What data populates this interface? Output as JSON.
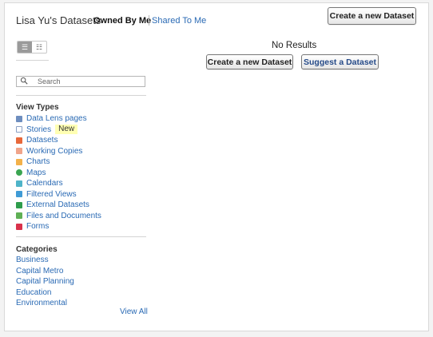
{
  "header": {
    "title": "Lisa Yu's Datasets",
    "tabs": [
      {
        "label": "Owned By Me",
        "active": true
      },
      {
        "label": "Shared To Me",
        "active": false
      }
    ],
    "create_button": "Create a new Dataset"
  },
  "view_toggle": {
    "options": [
      "list-detail-icon",
      "list-compact-icon"
    ],
    "selected": "list-detail-icon"
  },
  "search": {
    "placeholder": "Search",
    "value": ""
  },
  "view_types": {
    "heading": "View Types",
    "items": [
      {
        "label": "Data Lens pages",
        "icon": "data-lens-icon",
        "color": "#6e8ebf"
      },
      {
        "label": "Stories",
        "icon": "stories-icon",
        "color": "#8aa0c4",
        "badge": "New"
      },
      {
        "label": "Datasets",
        "icon": "dataset-icon",
        "color": "#e8683a"
      },
      {
        "label": "Working Copies",
        "icon": "working-copy-icon",
        "color": "#f0a48a"
      },
      {
        "label": "Charts",
        "icon": "chart-icon",
        "color": "#f3b14a"
      },
      {
        "label": "Maps",
        "icon": "map-icon",
        "color": "#3aa551"
      },
      {
        "label": "Calendars",
        "icon": "calendar-icon",
        "color": "#4fb4c9"
      },
      {
        "label": "Filtered Views",
        "icon": "filter-icon",
        "color": "#3f9bd6"
      },
      {
        "label": "External Datasets",
        "icon": "external-dataset-icon",
        "color": "#2e9d4c"
      },
      {
        "label": "Files and Documents",
        "icon": "file-icon",
        "color": "#5fb055"
      },
      {
        "label": "Forms",
        "icon": "form-icon",
        "color": "#d9324b"
      }
    ]
  },
  "categories": {
    "heading": "Categories",
    "items": [
      "Business",
      "Capital Metro",
      "Capital Planning",
      "Education",
      "Environmental"
    ],
    "view_all": "View All"
  },
  "results": {
    "empty_text": "No Results",
    "create_button": "Create a new Dataset",
    "suggest_button": "Suggest a Dataset"
  },
  "colors": {
    "link": "#2a6ab4",
    "badge_bg": "#ffffb3",
    "suggest_text": "#254a88"
  }
}
